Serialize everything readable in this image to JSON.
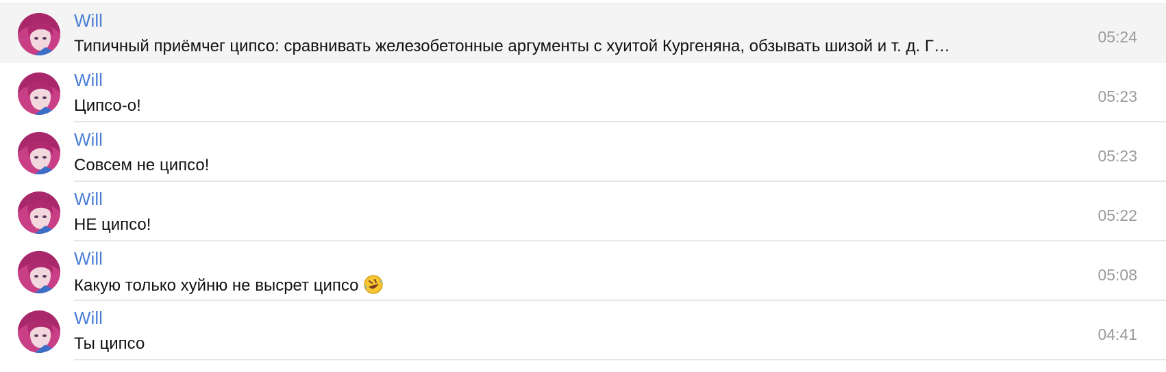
{
  "colors": {
    "sender_name": "#4a7ed6",
    "time": "#9a9a9a",
    "selected_row_bg": "#f4f4f4",
    "divider": "#e6e6e6"
  },
  "messages": [
    {
      "sender": "Will",
      "text": "Типичный приёмчег ципсо: сравнивать железобетонные аргументы с хуитой Кургеняна, обзывать шизой и т. д. Г…",
      "time": "05:24",
      "selected": true,
      "avatar_icon": "anime-avatar-icon"
    },
    {
      "sender": "Will",
      "text": "Ципсо-о!",
      "time": "05:23",
      "avatar_icon": "anime-avatar-icon"
    },
    {
      "sender": "Will",
      "text": "Совсем не ципсо!",
      "time": "05:23",
      "avatar_icon": "anime-avatar-icon"
    },
    {
      "sender": "Will",
      "text": "НЕ ципсо!",
      "time": "05:22",
      "avatar_icon": "anime-avatar-icon"
    },
    {
      "sender": "Will",
      "text": "Какую только хуйню не высрет ципсо",
      "emoji": "rolling-on-floor-laughing-emoji",
      "time": "05:08",
      "avatar_icon": "anime-avatar-icon"
    },
    {
      "sender": "Will",
      "text": "Ты ципсо",
      "time": "04:41",
      "avatar_icon": "anime-avatar-icon"
    }
  ]
}
